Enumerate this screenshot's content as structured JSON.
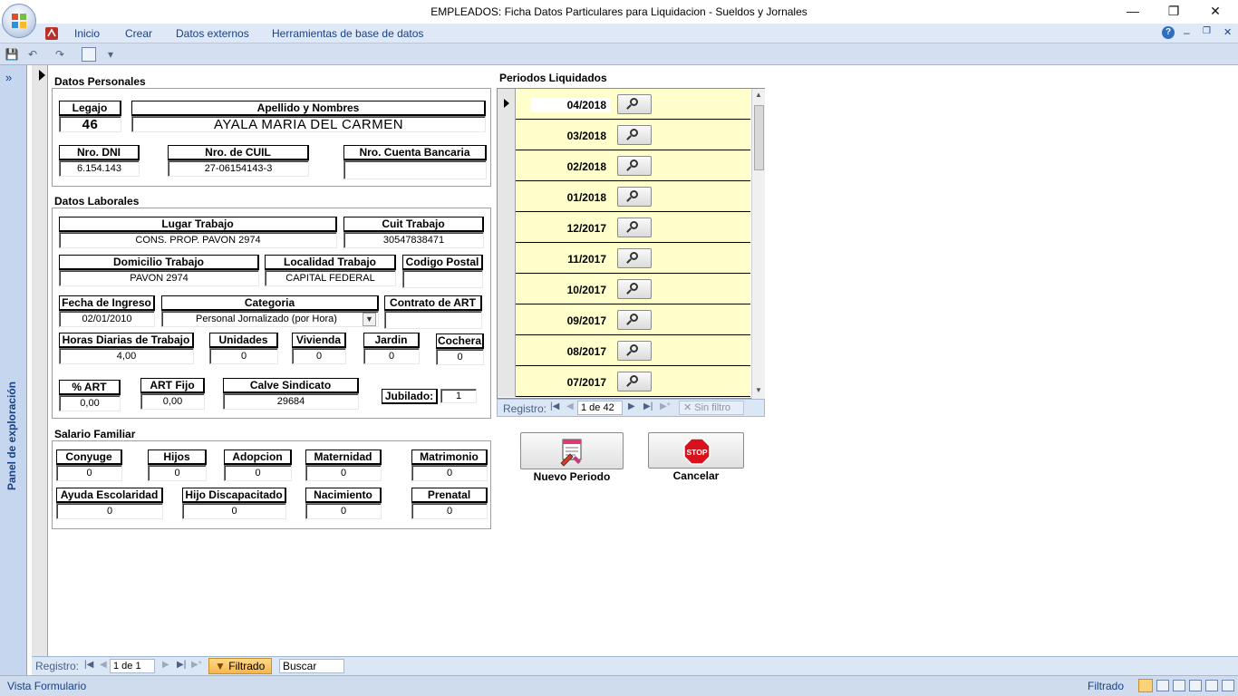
{
  "window": {
    "title": "EMPLEADOS: Ficha Datos Particulares para Liquidacion  -  Sueldos y Jornales",
    "minimize": "—",
    "restore": "❐",
    "close": "✕"
  },
  "ribbon": {
    "tabs": [
      "Inicio",
      "Crear",
      "Datos externos",
      "Herramientas de base de datos"
    ],
    "help": "?",
    "min": "–",
    "restore": "❐",
    "close": "✕"
  },
  "qat": {
    "save": "💾",
    "undo": "↶",
    "redo": "↷",
    "customize": "▾"
  },
  "nav": {
    "label": "Panel de exploración",
    "expand": "»"
  },
  "personal": {
    "section_title": "Datos Personales",
    "legajo_label": "Legajo",
    "legajo_value": "46",
    "nombre_label": "Apellido y Nombres",
    "nombre_value": "AYALA MARIA DEL CARMEN",
    "dni_label": "Nro. DNI",
    "dni_value": "6.154.143",
    "cuil_label": "Nro. de CUIL",
    "cuil_value": "27-06154143-3",
    "cuenta_label": "Nro. Cuenta Bancaria",
    "cuenta_value": ""
  },
  "laborales": {
    "section_title": "Datos Laborales",
    "lugar_label": "Lugar Trabajo",
    "lugar_value": "CONS. PROP. PAVON 2974",
    "cuit_label": "Cuit Trabajo",
    "cuit_value": "30547838471",
    "domicilio_label": "Domicilio Trabajo",
    "domicilio_value": "PAVON 2974",
    "localidad_label": "Localidad Trabajo",
    "localidad_value": "CAPITAL FEDERAL",
    "cp_label": "Codigo Postal",
    "cp_value": "",
    "ingreso_label": "Fecha de Ingreso",
    "ingreso_value": "02/01/2010",
    "categoria_label": "Categoria",
    "categoria_value": "Personal Jornalizado (por Hora)",
    "art_contrato_label": "Contrato de ART",
    "art_contrato_value": "",
    "horas_label": "Horas Diarias de Trabajo",
    "horas_value": "4,00",
    "unidades_label": "Unidades",
    "unidades_value": "0",
    "vivienda_label": "Vivienda",
    "vivienda_value": "0",
    "jardin_label": "Jardin",
    "jardin_value": "0",
    "cochera_label": "Cochera",
    "cochera_value": "0",
    "art_pct_label": "% ART",
    "art_pct_value": "0,00",
    "art_fijo_label": "ART Fijo",
    "art_fijo_value": "0,00",
    "sindicato_label": "Calve Sindicato",
    "sindicato_value": "29684",
    "jubilado_label": "Jubilado:",
    "jubilado_value": "1"
  },
  "familiar": {
    "section_title": "Salario Familiar",
    "conyuge_label": "Conyuge",
    "conyuge_value": "0",
    "hijos_label": "Hijos",
    "hijos_value": "0",
    "adopcion_label": "Adopcion",
    "adopcion_value": "0",
    "maternidad_label": "Maternidad",
    "maternidad_value": "0",
    "matrimonio_label": "Matrimonio",
    "matrimonio_value": "0",
    "escolaridad_label": "Ayuda Escolaridad",
    "escolaridad_value": "0",
    "discapacitado_label": "Hijo Discapacitado",
    "discapacitado_value": "0",
    "nacimiento_label": "Nacimiento",
    "nacimiento_value": "0",
    "prenatal_label": "Prenatal",
    "prenatal_value": "0"
  },
  "periodos": {
    "title": "Periodos Liquidados",
    "rows": [
      "04/2018",
      "03/2018",
      "02/2018",
      "01/2018",
      "12/2017",
      "11/2017",
      "10/2017",
      "09/2017",
      "08/2017",
      "07/2017"
    ],
    "registro_label": "Registro:",
    "registro_value": "1 de 42",
    "filter_label": "Sin filtro"
  },
  "actions": {
    "nuevo_label": "Nuevo Periodo",
    "cancelar_label": "Cancelar",
    "stop_text": "STOP"
  },
  "recnav": {
    "registro_label": "Registro:",
    "registro_value": "1 de 1",
    "filtrado_label": "Filtrado",
    "buscar_label": "Buscar"
  },
  "status": {
    "left": "Vista Formulario",
    "right": "Filtrado"
  }
}
